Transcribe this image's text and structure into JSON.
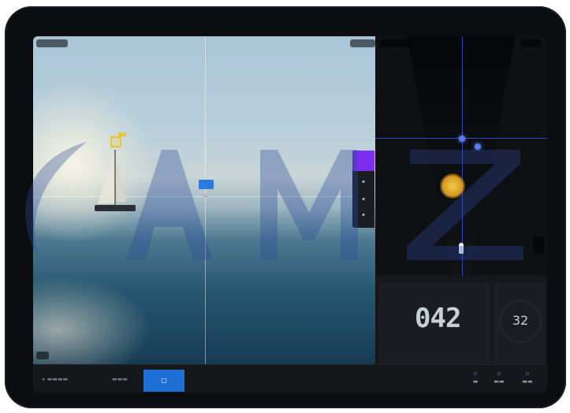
{
  "photo": {
    "top_left_pill": "",
    "top_right_pill": "",
    "crosshair_tag": ""
  },
  "side_rail": {
    "items": [
      "",
      "",
      ""
    ]
  },
  "radar": {
    "top_label": "",
    "mid_label": "",
    "ring_label": ""
  },
  "stats": {
    "heading_value": "042",
    "speed_value": "32"
  },
  "bottom_bar": {
    "active_label": ""
  },
  "colors": {
    "accent_blue": "#1f6fd6",
    "accent_purple": "#7b2ff0",
    "target_yellow": "#e8c63a",
    "radar_line": "#2f45b8"
  },
  "icons": [
    "sailboat-icon",
    "target-box-icon",
    "sun-marker-icon",
    "ship-marker-icon"
  ]
}
